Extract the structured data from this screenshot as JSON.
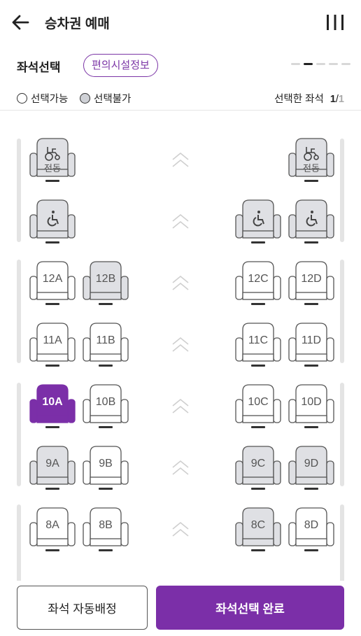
{
  "header": {
    "title": "승차권 예매",
    "back_icon": "arrow-left-icon",
    "menu_icon": "menu-bars-icon"
  },
  "subhead": {
    "title": "좌석선택",
    "facility_button": "편의시설정보",
    "car_pages": 5,
    "active_car_page": 2
  },
  "legend": {
    "available": "선택가능",
    "unavailable": "선택불가",
    "selected_label": "선택한 좌석",
    "selected_count": "1",
    "separator": "/",
    "total_count": "1"
  },
  "colors": {
    "accent": "#7b2fa8",
    "seat_available_fill": "#ffffff",
    "seat_unavailable_fill": "#dfe0e4",
    "seat_outline": "#555555"
  },
  "seat_rows": [
    {
      "left": [
        {
          "label": "전동",
          "state": "unavailable",
          "icon": "power-wheelchair-icon"
        },
        null
      ],
      "right": [
        null,
        {
          "label": "전동",
          "state": "unavailable",
          "icon": "power-wheelchair-icon"
        }
      ]
    },
    {
      "left": [
        {
          "label": "",
          "state": "unavailable",
          "icon": "wheelchair-icon"
        },
        null
      ],
      "right": [
        {
          "label": "",
          "state": "unavailable",
          "icon": "wheelchair-icon"
        },
        {
          "label": "",
          "state": "unavailable",
          "icon": "wheelchair-icon"
        }
      ]
    },
    {
      "left": [
        {
          "label": "12A",
          "state": "available"
        },
        {
          "label": "12B",
          "state": "unavailable"
        }
      ],
      "right": [
        {
          "label": "12C",
          "state": "available"
        },
        {
          "label": "12D",
          "state": "available"
        }
      ]
    },
    {
      "left": [
        {
          "label": "11A",
          "state": "available"
        },
        {
          "label": "11B",
          "state": "available"
        }
      ],
      "right": [
        {
          "label": "11C",
          "state": "available"
        },
        {
          "label": "11D",
          "state": "available"
        }
      ]
    },
    {
      "left": [
        {
          "label": "10A",
          "state": "selected"
        },
        {
          "label": "10B",
          "state": "available"
        }
      ],
      "right": [
        {
          "label": "10C",
          "state": "available"
        },
        {
          "label": "10D",
          "state": "available"
        }
      ]
    },
    {
      "left": [
        {
          "label": "9A",
          "state": "unavailable"
        },
        {
          "label": "9B",
          "state": "available"
        }
      ],
      "right": [
        {
          "label": "9C",
          "state": "unavailable"
        },
        {
          "label": "9D",
          "state": "unavailable"
        }
      ]
    },
    {
      "left": [
        {
          "label": "8A",
          "state": "available"
        },
        {
          "label": "8B",
          "state": "available"
        }
      ],
      "right": [
        {
          "label": "8C",
          "state": "unavailable"
        },
        {
          "label": "8D",
          "state": "available"
        }
      ]
    }
  ],
  "footer": {
    "auto_assign": "좌석 자동배정",
    "complete": "좌석선택 완료"
  }
}
